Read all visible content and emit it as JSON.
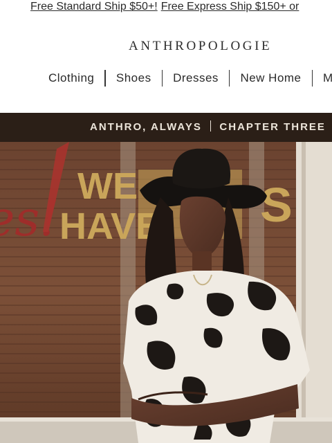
{
  "promo": {
    "standard": "Free Standard Ship $50+!",
    "express": "Free Express Ship $150+ or"
  },
  "brand": {
    "logo": "ANTHROPOLOGIE"
  },
  "nav": {
    "items": [
      {
        "label": "Clothing"
      },
      {
        "label": "Shoes"
      },
      {
        "label": "Dresses"
      },
      {
        "label": "New Home"
      },
      {
        "label": "M"
      }
    ]
  },
  "hero": {
    "left": "ANTHRO, ALWAYS",
    "right": "CHAPTER THREE",
    "window_text_1": "WE",
    "window_text_2": "HAVE",
    "window_text_3": "S",
    "script_text": "es!"
  }
}
